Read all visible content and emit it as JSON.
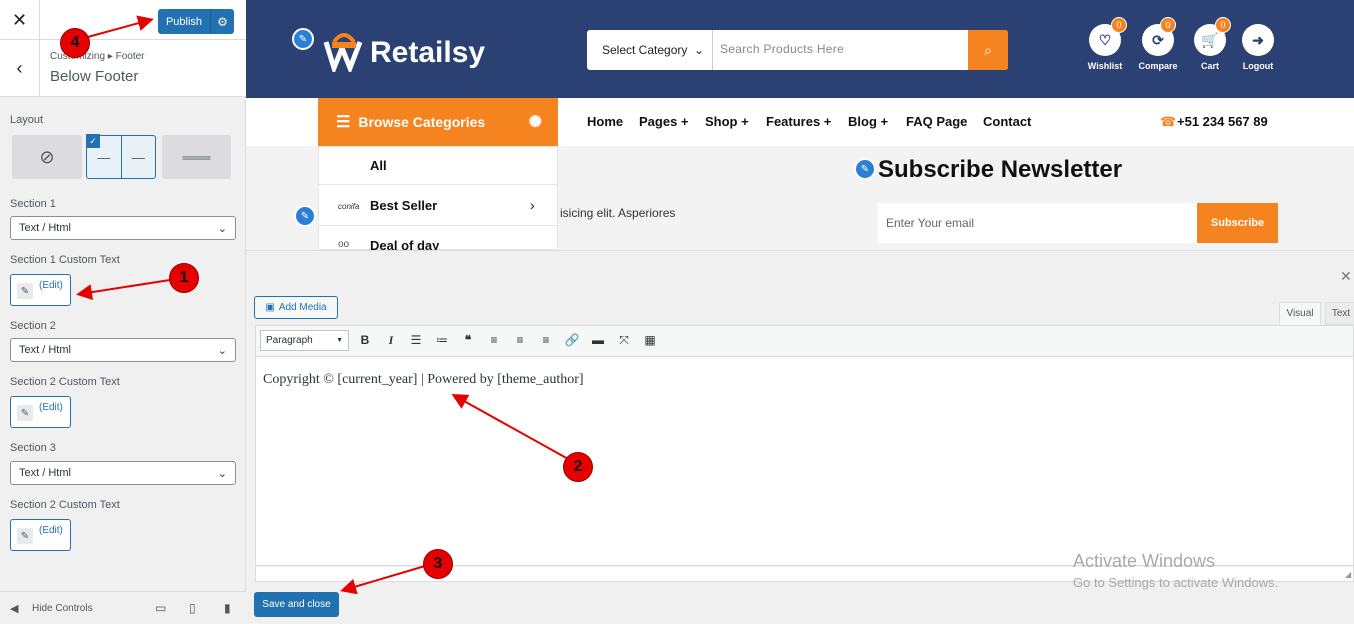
{
  "customizer": {
    "publish_label": "Publish",
    "breadcrumb": "Customizing ▸ Footer",
    "panel_title": "Below Footer",
    "layout_label": "Layout",
    "section1_label": "Section 1",
    "section1_value": "Text / Html",
    "section1_custom_label": "Section 1 Custom Text",
    "section2_label": "Section 2",
    "section2_value": "Text / Html",
    "section2_custom_label": "Section 2 Custom Text",
    "section3_label": "Section 3",
    "section3_value": "Text / Html",
    "section3_custom_label": "Section 2 Custom Text",
    "edit_label": "(Edit)",
    "hide_controls": "Hide Controls"
  },
  "site": {
    "logo": "Retailsy",
    "category_select": "Select Category",
    "search_placeholder": "Search Products Here",
    "header_icons": [
      {
        "label": "Wishlist",
        "count": "0",
        "icon": "heart-icon"
      },
      {
        "label": "Compare",
        "count": "0",
        "icon": "refresh-icon"
      },
      {
        "label": "Cart",
        "count": "0",
        "icon": "cart-icon"
      },
      {
        "label": "Logout",
        "icon": "logout-icon"
      }
    ],
    "browse_label": "Browse Categories",
    "nav": [
      "Home",
      "Pages +",
      "Shop +",
      "Features +",
      "Blog +",
      "FAQ Page",
      "Contact"
    ],
    "phone": "+51 234 567 89",
    "categories": [
      "All",
      "Best Seller",
      "Deal of day"
    ],
    "category_brand": "conifa",
    "newsletter_title": "Subscribe Newsletter",
    "email_placeholder": "Enter Your email",
    "subscribe_label": "Subscribe",
    "lorem_text": "isicing elit. Asperiores"
  },
  "editor": {
    "add_media": "Add Media",
    "tab_visual": "Visual",
    "tab_text": "Text",
    "format": "Paragraph",
    "content": "Copyright © [current_year] | Powered by [theme_author]",
    "save_close": "Save and close"
  },
  "watermark": {
    "line1": "Activate Windows",
    "line2": "Go to Settings to activate Windows."
  },
  "annotations": [
    "1",
    "2",
    "3",
    "4"
  ],
  "colors": {
    "accent": "#f5831f",
    "header": "#2b4073",
    "wp_blue": "#2271b1",
    "annotation": "#e60000"
  }
}
